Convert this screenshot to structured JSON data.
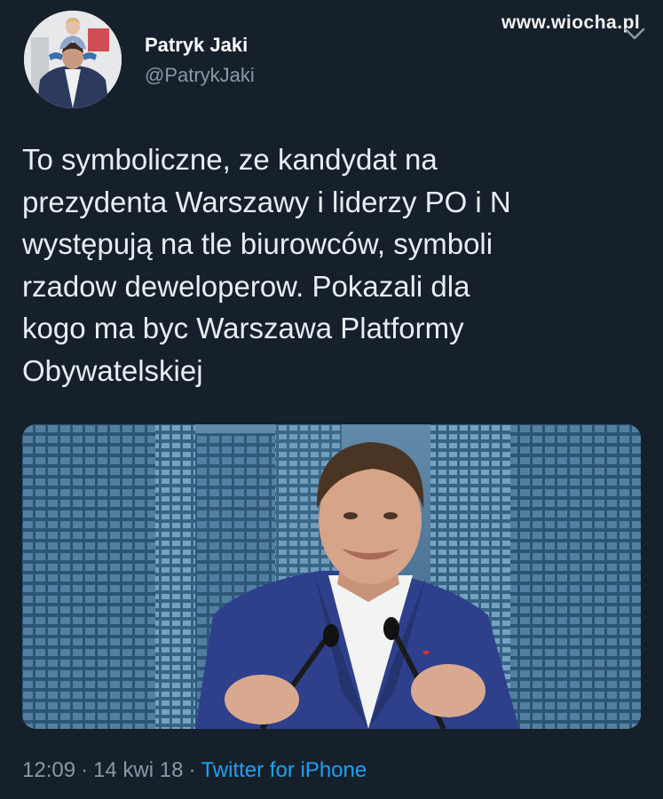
{
  "watermark": "www.wiocha.pl",
  "author": {
    "name": "Patryk Jaki",
    "handle": "@PatrykJaki"
  },
  "tweet": {
    "lines": [
      "To symboliczne, ze kandydat na",
      "prezydenta Warszawy i liderzy PO i N",
      "występują na tle biurowców, symboli",
      "rzadow deweloperow. Pokazali dla",
      "kogo ma byc Warszawa Platformy",
      "Obywatelskiej"
    ]
  },
  "meta": {
    "time": "12:09",
    "separator": "·",
    "date": "14 kwi 18",
    "source": "Twitter for iPhone"
  },
  "colors": {
    "background": "#15202b",
    "text": "#e9eef2",
    "secondary": "#8899a6",
    "link": "#1da1f2"
  },
  "icons": [
    "chevron-down-icon"
  ]
}
